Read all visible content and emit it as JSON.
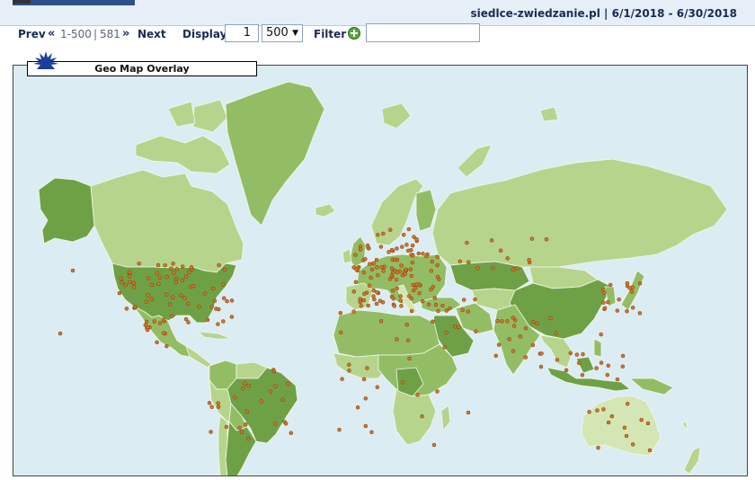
{
  "header": {
    "title": "siedlce-zwiedzanie.pl  |  6/1/2018 - 6/30/2018"
  },
  "toolbar": {
    "prev_label": "Prev",
    "first_glyph": "«",
    "range": "1-500",
    "separator": "|",
    "total": "581",
    "last_glyph": "»",
    "next_label": "Next",
    "display_label": "Display",
    "display_value": "1",
    "select_value": "500",
    "select_arrow": "▼",
    "filter_label": "Filter",
    "filter_value": ""
  },
  "gadget": {
    "title": "Geo Map Overlay",
    "icon": "starburst-icon"
  },
  "colors": {
    "ocean": "#dcecf3",
    "land_pale": "#d5e6b5",
    "land_light": "#b7d48d",
    "land_mid": "#93bd64",
    "land_dark": "#6ea145",
    "dot": "#d0772a",
    "dot_stroke": "#7a3b0c",
    "header_text": "#1a2a55",
    "burst": "#1b3f9a"
  }
}
